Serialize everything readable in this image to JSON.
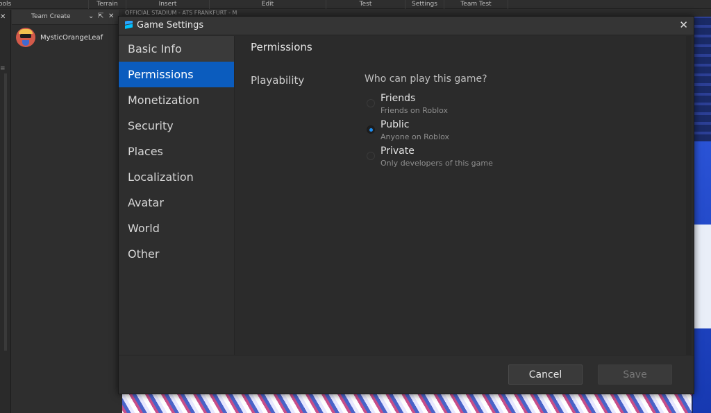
{
  "ribbon": {
    "groups": [
      "Tools",
      "Terrain",
      "Insert",
      "Edit",
      "Test",
      "Settings",
      "Team Test"
    ]
  },
  "team_create": {
    "title": "Team Create",
    "user": "MysticOrangeLeaf"
  },
  "viewport": {
    "tab_title": "OFFICIAL STADIUM - ATS FRANKFURT - M"
  },
  "dialog": {
    "title": "Game Settings",
    "nav": [
      {
        "label": "Basic Info"
      },
      {
        "label": "Permissions"
      },
      {
        "label": "Monetization"
      },
      {
        "label": "Security"
      },
      {
        "label": "Places"
      },
      {
        "label": "Localization"
      },
      {
        "label": "Avatar"
      },
      {
        "label": "World"
      },
      {
        "label": "Other"
      }
    ],
    "active_nav": "Permissions",
    "page_title": "Permissions",
    "section_label": "Playability",
    "question": "Who can play this game?",
    "options": [
      {
        "title": "Friends",
        "subtitle": "Friends on Roblox",
        "selected": false
      },
      {
        "title": "Public",
        "subtitle": "Anyone on Roblox",
        "selected": true
      },
      {
        "title": "Private",
        "subtitle": "Only developers of this game",
        "selected": false
      }
    ],
    "buttons": {
      "cancel": "Cancel",
      "save": "Save"
    }
  },
  "colors": {
    "accent": "#0b5cbe",
    "radio_selected": "#1e8ff3"
  }
}
